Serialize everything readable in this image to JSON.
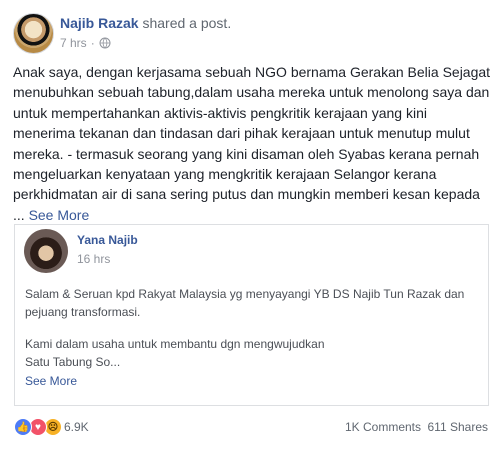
{
  "post": {
    "author": "Najib Razak",
    "action": "shared a post.",
    "time": "7 hrs",
    "text": "Anak saya, dengan kerjasama sebuah NGO bernama Gerakan Belia Sejagat menubuhkan sebuah tabung,dalam usaha mereka untuk menolong saya dan untuk mempertahankan aktivis-aktivis pengkritik kerajaan yang kini menerima tekanan dan tindasan dari pihak kerajaan untuk menutup mulut mereka. - termasuk seorang yang kini disaman oleh Syabas kerana pernah mengeluarkan kenyataan yang mengkritik kerajaan Selangor kerana perkhidmatan air di sana sering putus dan mungkin memberi kesan kepada",
    "ellipsis": "... ",
    "see_more": "See More"
  },
  "shared_post": {
    "author": "Yana Najib",
    "time": "16 hrs",
    "paragraph1": "Salam & Seruan kpd Rakyat Malaysia yg menyayangi YB DS Najib Tun Razak dan pejuang transformasi.",
    "paragraph2_line1": "Kami dalam usaha untuk membantu dgn mengwujudkan",
    "paragraph2_line2": "Satu Tabung So...",
    "see_more": "See More"
  },
  "footer": {
    "reaction_count": "6.9K",
    "comments": "1K Comments",
    "shares": "611 Shares"
  },
  "icons": [
    "avatar",
    "globe-icon",
    "like-icon",
    "love-icon",
    "sad-icon"
  ],
  "colors": {
    "link": "#385898",
    "text": "#1d2129",
    "muted": "#90949c"
  }
}
